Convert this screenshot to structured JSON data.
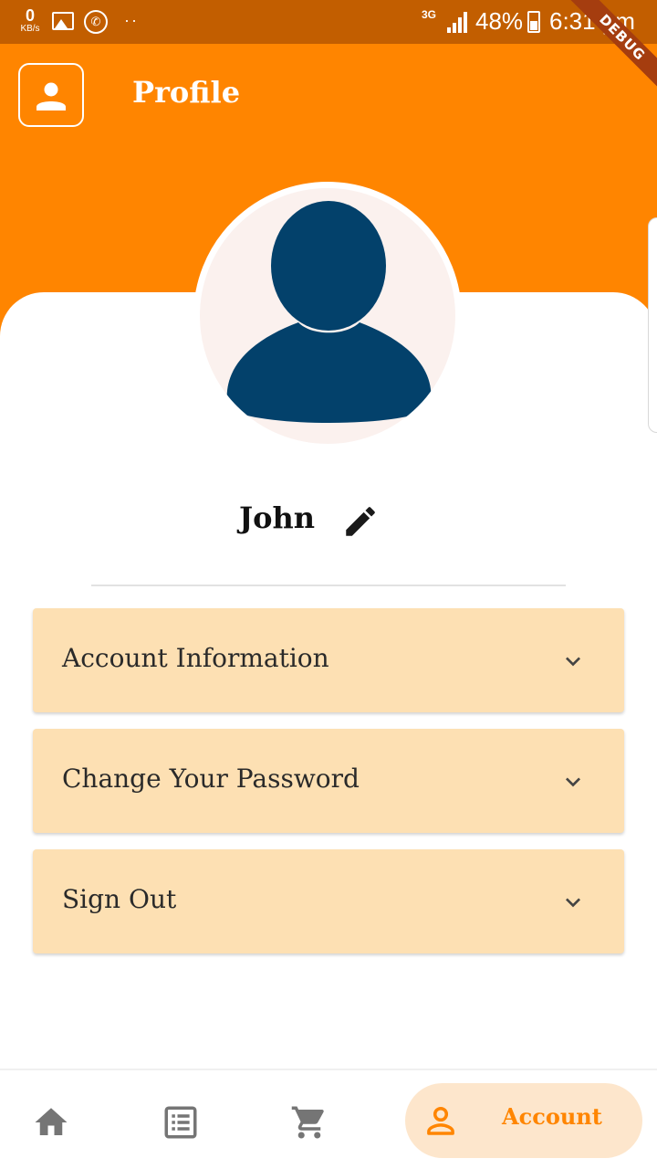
{
  "status_bar": {
    "net_speed_value": "0",
    "net_speed_unit": "KB/s",
    "network_type": "3G",
    "battery_percent": "48%",
    "time": "6:31 pm",
    "debug_label": "DEBUG"
  },
  "header": {
    "title": "Profile",
    "background_color": "#ff8500",
    "status_bar_color": "#c25e00"
  },
  "profile": {
    "name": "John",
    "avatar_icon": "person-icon",
    "avatar_color": "#03416b"
  },
  "menu": {
    "items": [
      {
        "label": "Account Information",
        "icon": "chevron-down-icon"
      },
      {
        "label": "Change Your Password",
        "icon": "chevron-down-icon"
      },
      {
        "label": "Sign Out",
        "icon": "chevron-down-icon"
      }
    ],
    "tile_color": "#fde0b3"
  },
  "bottom_nav": {
    "items": [
      {
        "icon": "home-icon"
      },
      {
        "icon": "list-icon"
      },
      {
        "icon": "cart-icon"
      },
      {
        "icon": "account-icon",
        "label": "Account",
        "active": true
      }
    ],
    "active_color": "#ff8500",
    "inactive_color": "#757575"
  }
}
